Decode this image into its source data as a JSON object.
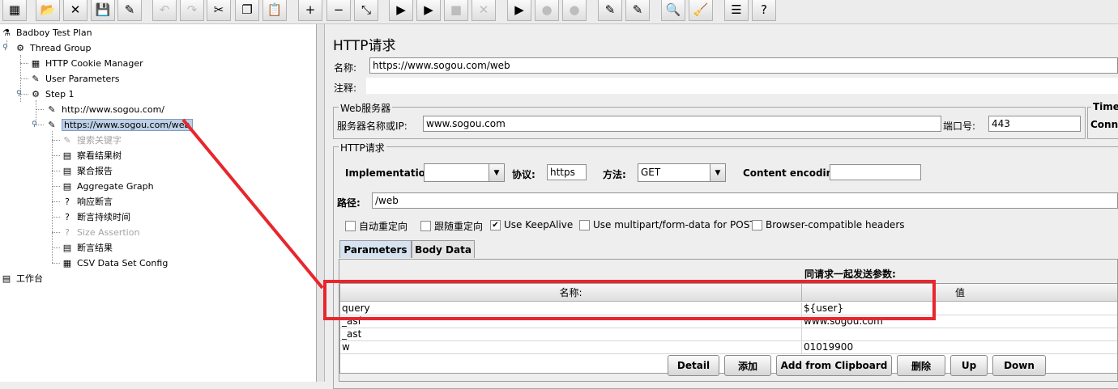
{
  "toolbar": {
    "buttons": [
      {
        "name": "templates-icon",
        "glyph": "▦",
        "enabled": true
      },
      {
        "name": "open-icon",
        "glyph": "📂",
        "enabled": true
      },
      {
        "name": "close-icon",
        "glyph": "✕",
        "enabled": true
      },
      {
        "name": "save-icon",
        "glyph": "💾",
        "enabled": true
      },
      {
        "name": "save-as-icon",
        "glyph": "✎",
        "enabled": true
      },
      {
        "name": "undo-icon",
        "glyph": "↶",
        "enabled": false
      },
      {
        "name": "redo-icon",
        "glyph": "↷",
        "enabled": false
      },
      {
        "name": "cut-icon",
        "glyph": "✂",
        "enabled": true
      },
      {
        "name": "copy-icon",
        "glyph": "❐",
        "enabled": true
      },
      {
        "name": "paste-icon",
        "glyph": "📋",
        "enabled": true
      },
      {
        "name": "expand-icon",
        "glyph": "+",
        "enabled": true
      },
      {
        "name": "collapse-icon",
        "glyph": "−",
        "enabled": true
      },
      {
        "name": "toggle-icon",
        "glyph": "⤡",
        "enabled": true
      },
      {
        "name": "start-icon",
        "glyph": "▶",
        "enabled": true
      },
      {
        "name": "start-no-pauses-icon",
        "glyph": "▶",
        "enabled": true
      },
      {
        "name": "stop-icon",
        "glyph": "■",
        "enabled": false
      },
      {
        "name": "shutdown-icon",
        "glyph": "✕",
        "enabled": false
      },
      {
        "name": "remote-start-icon",
        "glyph": "▶",
        "enabled": true
      },
      {
        "name": "remote-stop-icon",
        "glyph": "●",
        "enabled": false
      },
      {
        "name": "remote-exit-icon",
        "glyph": "●",
        "enabled": false
      },
      {
        "name": "clear-icon",
        "glyph": "✎",
        "enabled": true
      },
      {
        "name": "clear-all-icon",
        "glyph": "✎",
        "enabled": true
      },
      {
        "name": "search-icon",
        "glyph": "🔍",
        "enabled": true
      },
      {
        "name": "reset-search-icon",
        "glyph": "🧹",
        "enabled": true
      },
      {
        "name": "function-helper-icon",
        "glyph": "☰",
        "enabled": true
      },
      {
        "name": "help-icon",
        "glyph": "?",
        "enabled": true
      }
    ]
  },
  "tree": {
    "nodes": [
      {
        "label": "Badboy Test Plan",
        "icon": "⚗",
        "depth": 0,
        "disabled": false,
        "selected": false
      },
      {
        "label": "Thread Group",
        "icon": "⚙",
        "depth": 1,
        "disabled": false,
        "selected": false
      },
      {
        "label": "HTTP Cookie Manager",
        "icon": "▦",
        "depth": 2,
        "disabled": false,
        "selected": false
      },
      {
        "label": "User Parameters",
        "icon": "✎",
        "depth": 2,
        "disabled": false,
        "selected": false
      },
      {
        "label": "Step 1",
        "icon": "⚙",
        "depth": 2,
        "disabled": false,
        "selected": false
      },
      {
        "label": "http://www.sogou.com/",
        "icon": "✎",
        "depth": 3,
        "disabled": false,
        "selected": false
      },
      {
        "label": "https://www.sogou.com/web",
        "icon": "✎",
        "depth": 3,
        "disabled": false,
        "selected": true
      },
      {
        "label": "搜索关键字",
        "icon": "✎",
        "depth": 4,
        "disabled": true,
        "selected": false
      },
      {
        "label": "察看结果树",
        "icon": "▤",
        "depth": 4,
        "disabled": false,
        "selected": false
      },
      {
        "label": "聚合报告",
        "icon": "▤",
        "depth": 4,
        "disabled": false,
        "selected": false
      },
      {
        "label": "Aggregate Graph",
        "icon": "▤",
        "depth": 4,
        "disabled": false,
        "selected": false
      },
      {
        "label": "响应断言",
        "icon": "?",
        "depth": 4,
        "disabled": false,
        "selected": false
      },
      {
        "label": "断言持续时间",
        "icon": "?",
        "depth": 4,
        "disabled": false,
        "selected": false
      },
      {
        "label": "Size Assertion",
        "icon": "?",
        "depth": 4,
        "disabled": true,
        "selected": false
      },
      {
        "label": "断言结果",
        "icon": "▤",
        "depth": 4,
        "disabled": false,
        "selected": false
      },
      {
        "label": "CSV Data Set Config",
        "icon": "▦",
        "depth": 4,
        "disabled": false,
        "selected": false
      },
      {
        "label": "工作台",
        "icon": "▤",
        "depth": 0,
        "disabled": false,
        "selected": false
      }
    ]
  },
  "panel": {
    "title": "HTTP请求",
    "name_label": "名称:",
    "name_value": "https://www.sogou.com/web",
    "comment_label": "注释:",
    "comment_value": "",
    "web_server_group": "Web服务器",
    "server_label": "服务器名称或IP:",
    "server_value": "www.sogou.com",
    "port_label": "端口号:",
    "port_value": "443",
    "timeouts_group": "Timeo",
    "connect_label": "Conne",
    "http_request_group": "HTTP请求",
    "implementation_label": "Implementation:",
    "implementation_value": "",
    "protocol_label": "协议:",
    "protocol_value": "https",
    "method_label": "方法:",
    "method_value": "GET",
    "encoding_label": "Content encoding:",
    "encoding_value": "",
    "path_label": "路径:",
    "path_value": "/web",
    "checkboxes": [
      {
        "label": "自动重定向",
        "checked": false
      },
      {
        "label": "跟随重定向",
        "checked": false
      },
      {
        "label": "Use KeepAlive",
        "checked": true
      },
      {
        "label": "Use multipart/form-data for POST",
        "checked": false
      },
      {
        "label": "Browser-compatible headers",
        "checked": false
      }
    ],
    "tabs": [
      {
        "label": "Parameters",
        "active": true
      },
      {
        "label": "Body Data",
        "active": false
      }
    ],
    "params_caption": "同请求一起发送参数:",
    "table": {
      "columns": [
        "名称:",
        "值"
      ],
      "rows": [
        [
          "query",
          "${user}"
        ],
        [
          "_asf",
          "www.sogou.com"
        ],
        [
          "_ast",
          ""
        ],
        [
          "w",
          "01019900"
        ]
      ]
    },
    "buttons": [
      "Detail",
      "添加",
      "Add from Clipboard",
      "删除",
      "Up",
      "Down"
    ]
  },
  "annotation": {
    "color": "#e8262d"
  }
}
